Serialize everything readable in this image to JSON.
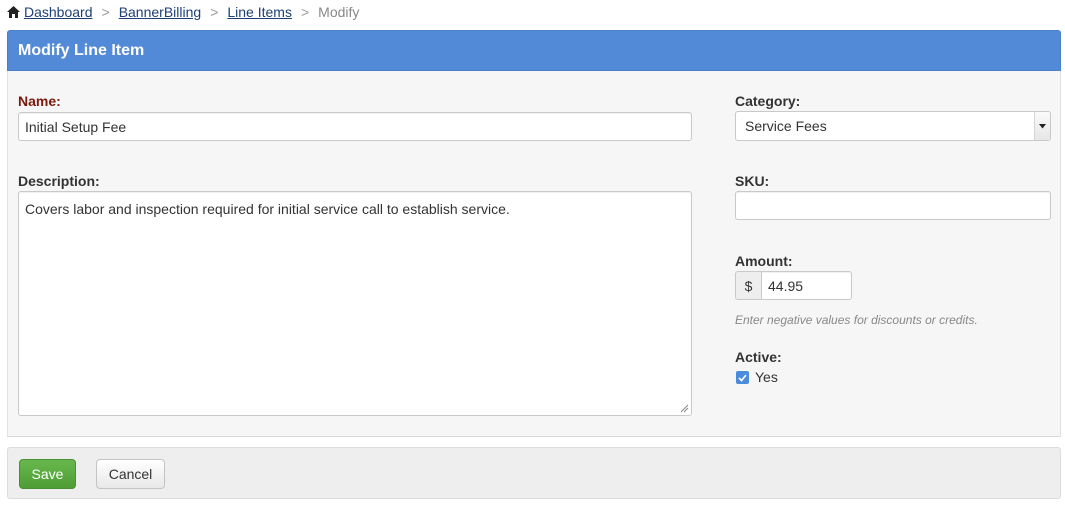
{
  "breadcrumb": {
    "items": [
      "Dashboard",
      "BannerBilling",
      "Line Items"
    ],
    "current": "Modify",
    "separator": ">"
  },
  "panel": {
    "title": "Modify Line Item"
  },
  "form": {
    "name_label": "Name:",
    "name_value": "Initial Setup Fee",
    "description_label": "Description:",
    "description_value": "Covers labor and inspection required for initial service call to establish service.",
    "category_label": "Category:",
    "category_value": "Service Fees",
    "sku_label": "SKU:",
    "sku_value": "",
    "amount_label": "Amount:",
    "amount_prefix": "$",
    "amount_value": "44.95",
    "amount_help": "Enter negative values for discounts or credits.",
    "active_label": "Active:",
    "active_option": "Yes",
    "active_checked": true
  },
  "footer": {
    "save_label": "Save",
    "cancel_label": "Cancel"
  },
  "colors": {
    "header": "#538ad7",
    "save": "#5aaa3f",
    "link": "#1f3f78",
    "required_label": "#7a1a0c",
    "checkbox": "#4a8bdb"
  },
  "icons": [
    "home-icon",
    "chevron-down-icon",
    "check-icon",
    "resize-grip-icon"
  ]
}
